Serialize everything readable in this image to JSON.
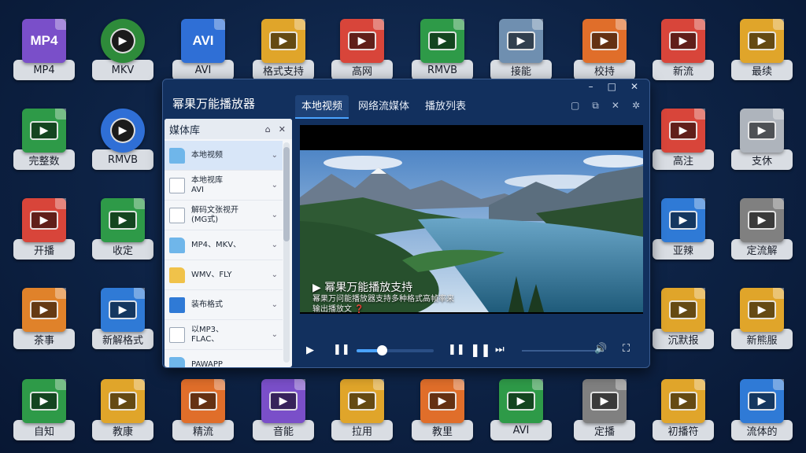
{
  "window": {
    "title": "幂果万能播放器",
    "tabs": [
      {
        "label": "本地视频",
        "active": true
      },
      {
        "label": "网络流媒体",
        "active": false
      },
      {
        "label": "播放列表",
        "active": false
      }
    ],
    "controls": {
      "minimize": "–",
      "maximize": "□",
      "close": "✕"
    },
    "tools": {
      "a": "▢",
      "b": "⧉",
      "c": "✕",
      "d": "✲"
    }
  },
  "sidebar": {
    "title": "媒体库",
    "items": [
      {
        "label": "本地视频",
        "icon": "folder-icon",
        "active": true
      },
      {
        "label": "本地视库\nAVI",
        "icon": "file-icon",
        "active": false
      },
      {
        "label": "解码文张视开\n(MG式)",
        "icon": "file-icon",
        "active": false
      },
      {
        "label": "MP4、MKV、",
        "icon": "folder-icon",
        "active": false
      },
      {
        "label": "WMV、FLY",
        "icon": "folder-yellow-icon",
        "active": false
      },
      {
        "label": "装布格式",
        "icon": "format-icon",
        "active": false
      },
      {
        "label": "以MP3、\nFLAC、",
        "icon": "file-icon",
        "active": false
      },
      {
        "label": "PAWAPP",
        "icon": "folder-icon",
        "active": false
      }
    ]
  },
  "player": {
    "overlay_title": "▶ 幂果万能播放支持",
    "overlay_sub": "幂果万问能播放器支持多种格式高帧率来\n输出播放文 ❓",
    "progress": 0.33
  },
  "tiles": [
    {
      "label": "MP4",
      "color": "#7a4fc9",
      "text": "MP4"
    },
    {
      "label": "MKV",
      "color": "#2e8b3a",
      "round": true
    },
    {
      "label": "AVI",
      "color": "#2f6fd6",
      "text": "AVI"
    },
    {
      "label": "格式支持",
      "color": "#e0a52a"
    },
    {
      "label": "高网",
      "color": "#d8453a"
    },
    {
      "label": "RMVB",
      "color": "#2e9a48"
    },
    {
      "label": "接能",
      "color": "#6f8fb0"
    },
    {
      "label": "校持",
      "color": "#e06e2a"
    },
    {
      "label": "新流",
      "color": "#d8453a"
    },
    {
      "label": "最续",
      "color": "#e0a52a"
    },
    {
      "label": "完整数",
      "color": "#2e9a48"
    },
    {
      "label": "RMVB",
      "color": "#2f6fd6",
      "round": true
    },
    {
      "label": "高注",
      "color": "#d8453a"
    },
    {
      "label": "支休",
      "color": "#aeb4bc"
    },
    {
      "label": "开播",
      "color": "#d8453a"
    },
    {
      "label": "收定",
      "color": "#2e9a48"
    },
    {
      "label": "亚辣",
      "color": "#2f7ad6"
    },
    {
      "label": "定流解",
      "color": "#808080"
    },
    {
      "label": "茶事",
      "color": "#e0822a"
    },
    {
      "label": "新解格式",
      "color": "#2f7ad6"
    },
    {
      "label": "沉默报",
      "color": "#e0a52a"
    },
    {
      "label": "新熊服",
      "color": "#e0a52a"
    },
    {
      "label": "自知",
      "color": "#2e9a48"
    },
    {
      "label": "教康",
      "color": "#e0a52a"
    },
    {
      "label": "精流",
      "color": "#e06e2a"
    },
    {
      "label": "音能",
      "color": "#7a4fc9"
    },
    {
      "label": "拉用",
      "color": "#e0a52a"
    },
    {
      "label": "教里",
      "color": "#e06e2a"
    },
    {
      "label": "AVI",
      "color": "#2e9a48"
    },
    {
      "label": "定播",
      "color": "#808080"
    },
    {
      "label": "初播符",
      "color": "#e0a52a"
    },
    {
      "label": "流体的",
      "color": "#2f7ad6"
    }
  ]
}
